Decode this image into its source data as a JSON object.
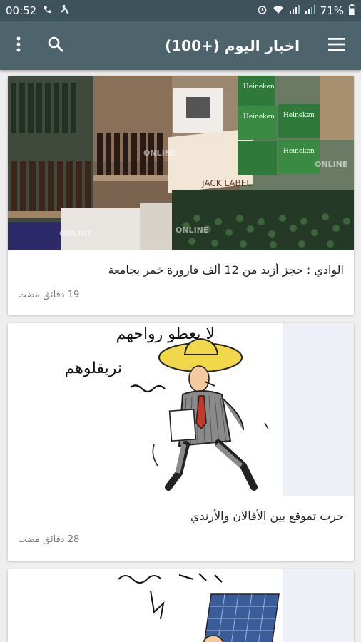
{
  "status_bar": {
    "time": "00:52",
    "battery": "71%"
  },
  "app_bar": {
    "title": "اخبار اليوم (+100)",
    "menu_icon": "menu-icon",
    "search_icon": "search-icon",
    "more_icon": "more-vert-icon"
  },
  "articles": [
    {
      "title": "الوادي : حجز أزيد من 12 ألف قارورة خمر بجامعة",
      "time": "19 دقائق مضت",
      "image_labels": [
        "Heineken",
        "Heineken",
        "Heineken",
        "Heineken",
        "JACK LABEL",
        "ONLINE",
        "ONLINE",
        "ONLINE",
        "ONLINE"
      ]
    },
    {
      "title": "حرب تموقع بين الأفالان والأرندي",
      "time": "28 دقائق مضت",
      "image_labels": [
        "لا يعطو رواحهم",
        "نريقلوهم"
      ]
    },
    {
      "title": "",
      "time": "",
      "image_labels": []
    }
  ],
  "colors": {
    "status_bar": "#3d525a",
    "app_bar": "#4e646d",
    "background": "#eeeeee"
  }
}
